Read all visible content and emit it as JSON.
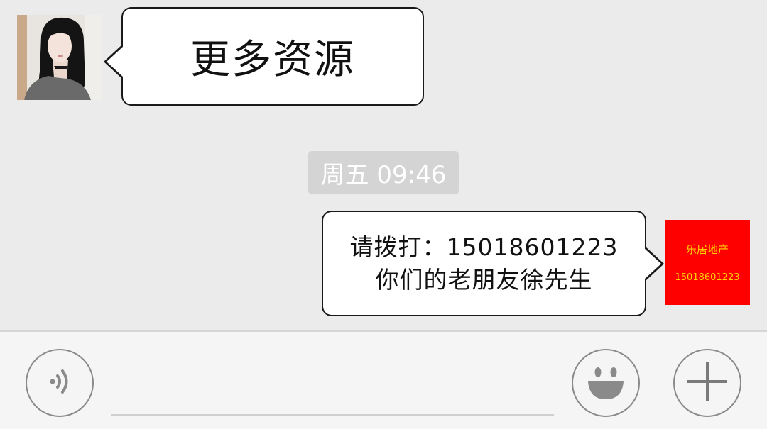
{
  "messages": {
    "incoming": {
      "text": "更多资源"
    },
    "timestamp": "周五 09:46",
    "outgoing": {
      "line1": "请拨打：15018601223",
      "line2": "你们的老朋友徐先生"
    }
  },
  "my_avatar": {
    "name": "乐居地产",
    "phone": "15018601223",
    "background_color": "#ff0000",
    "text_color": "#ffd200"
  },
  "input_bar": {
    "voice_icon": "voice-icon",
    "emoji_icon": "emoji-icon",
    "plus_icon": "plus-icon",
    "input_value": ""
  }
}
